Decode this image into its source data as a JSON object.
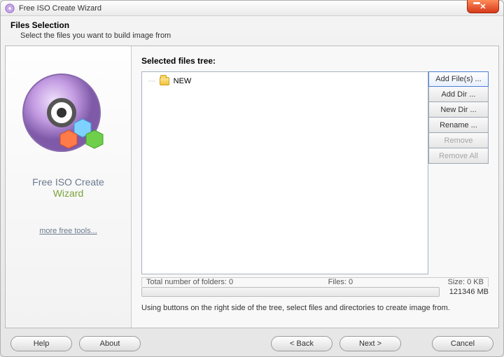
{
  "titlebar": {
    "title": "Free ISO Create Wizard"
  },
  "header": {
    "heading": "Files Selection",
    "subheading": "Select the files you want to build image from"
  },
  "sidebar": {
    "app_line1": "Free ISO Create",
    "app_line2": "Wizard",
    "more_link": "more free tools..."
  },
  "main": {
    "tree_label": "Selected files tree:",
    "tree": {
      "root_name": "NEW"
    },
    "buttons": {
      "add_files": "Add File(s) ...",
      "add_dir": "Add Dir ...",
      "new_dir": "New Dir ...",
      "rename": "Rename ...",
      "remove": "Remove",
      "remove_all": "Remove All"
    },
    "stats": {
      "folders": "Total number of folders: 0",
      "files": "Files: 0",
      "size": "Size: 0 KB"
    },
    "capacity": "121346 MB",
    "hint": "Using buttons on the right side of the tree, select files and directories to create image from."
  },
  "footer": {
    "help": "Help",
    "about": "About",
    "back": "< Back",
    "next": "Next >",
    "cancel": "Cancel"
  }
}
